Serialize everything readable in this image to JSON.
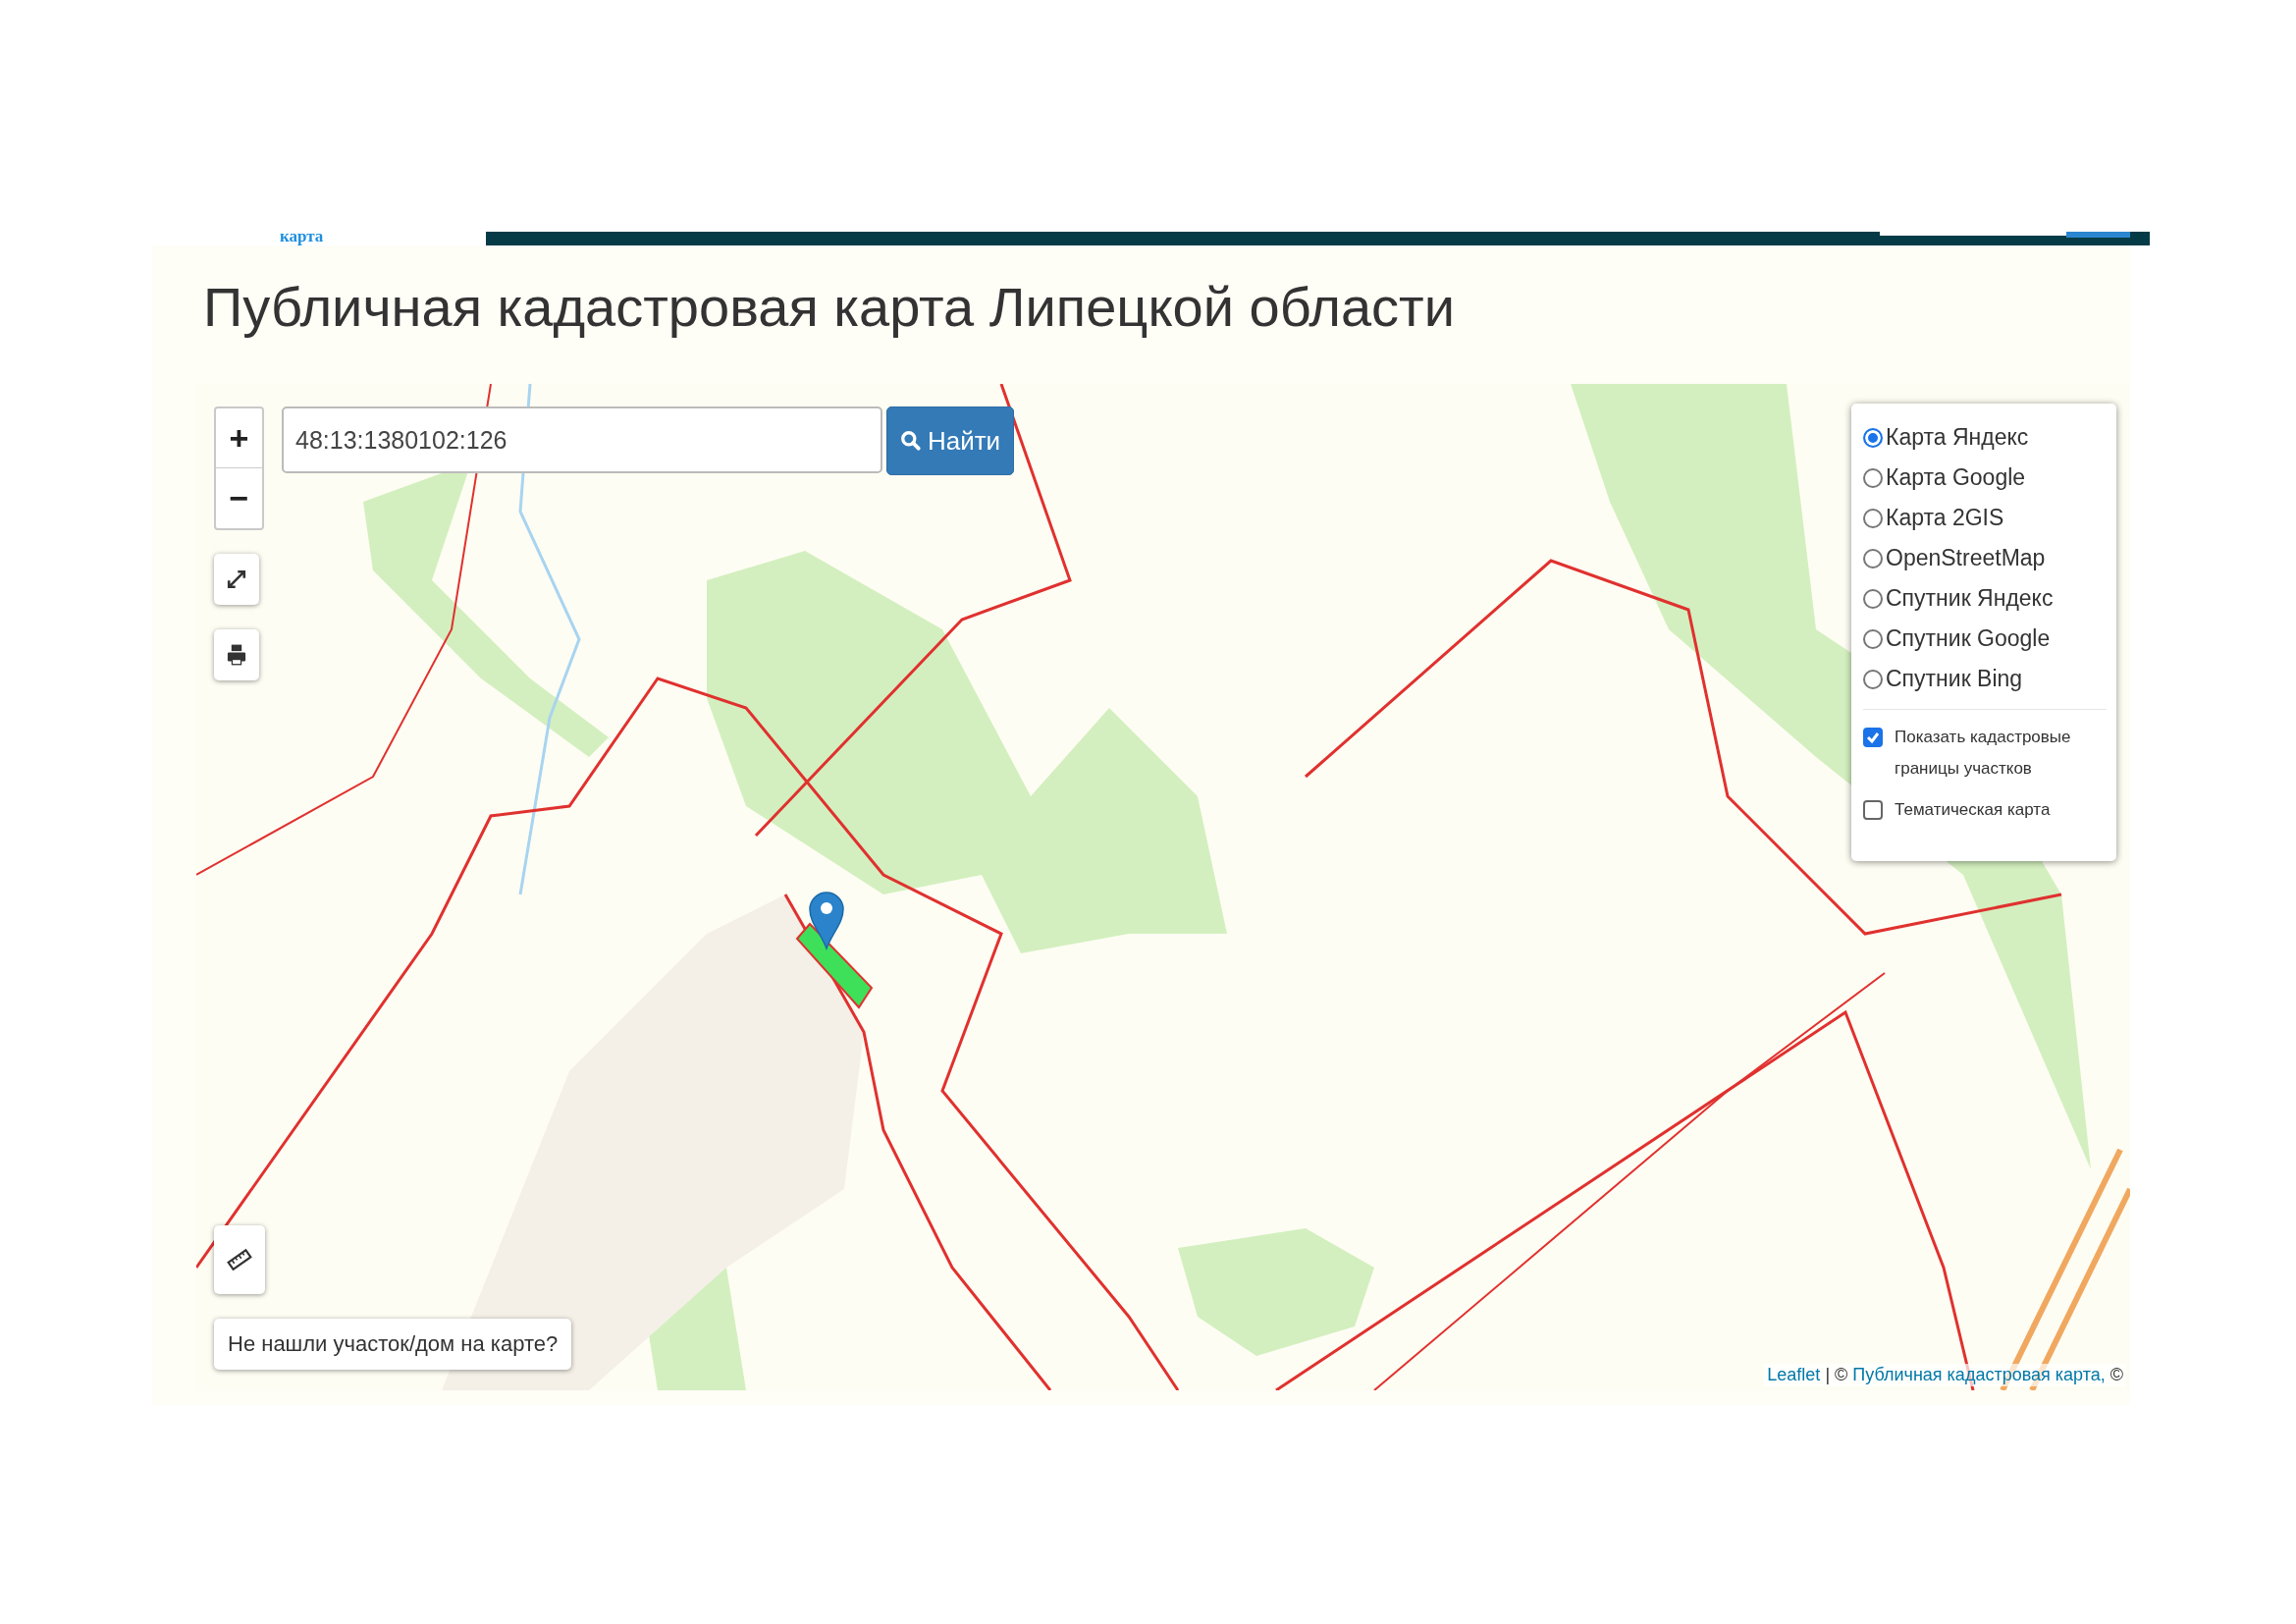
{
  "header": {
    "nav_link": "карта"
  },
  "title": "Публичная кадастровая карта Липецкой области",
  "map": {
    "zoom_controls": [
      "+",
      "−"
    ],
    "search": {
      "value": "48:13:1380102:126",
      "button": "Найти"
    },
    "base_layers": [
      {
        "label": "Карта Яндекс",
        "selected": true
      },
      {
        "label": "Карта Google",
        "selected": false
      },
      {
        "label": "Карта 2GIS",
        "selected": false
      },
      {
        "label": "OpenStreetMap",
        "selected": false
      },
      {
        "label": "Спутник Яндекс",
        "selected": false
      },
      {
        "label": "Спутник Google",
        "selected": false
      },
      {
        "label": "Спутник Bing",
        "selected": false
      }
    ],
    "overlays": [
      {
        "label": "Показать кадастровые границы участков",
        "checked": true
      },
      {
        "label": "Тематическая карта",
        "checked": false
      }
    ],
    "not_found_button": "Не нашли участок/дом на карте?",
    "attribution": [
      {
        "kind": "link",
        "text": "Leaflet"
      },
      {
        "kind": "text",
        "text": "| ©"
      },
      {
        "kind": "link",
        "text": "Публичная кадастровая карта,"
      },
      {
        "kind": "text",
        "text": "©"
      }
    ]
  }
}
